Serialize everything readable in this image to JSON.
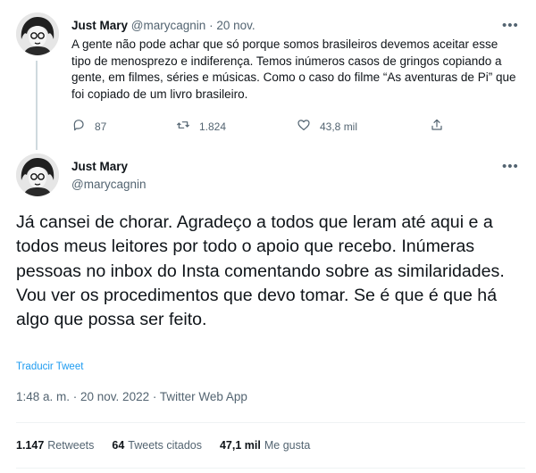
{
  "tweet1": {
    "name": "Just Mary",
    "handle": "@marycagnin",
    "separator": "·",
    "date": "20 nov.",
    "text": "A gente não pode achar que só porque somos brasileiros devemos aceitar esse tipo de menosprezo e indiferença. Temos inúmeros casos de gringos copiando a gente, em filmes, séries e músicas. Como o caso do filme “As aventuras de Pi” que foi copiado de um livro brasileiro.",
    "replies": "87",
    "retweets": "1.824",
    "likes": "43,8 mil",
    "icons": [
      "reply-icon",
      "retweet-icon",
      "heart-icon",
      "share-icon"
    ]
  },
  "tweet2": {
    "name": "Just Mary",
    "handle": "@marycagnin",
    "text": "Já cansei de chorar. Agradeço a todos que leram até aqui e a todos meus leitores por todo o apoio que recebo. Inúmeras pessoas no inbox do Insta comentando sobre as similaridades. Vou ver os procedimentos que devo tomar. Se é que é que há algo que possa ser feito.",
    "translate": "Traducir Tweet",
    "meta": "1:48 a. m. · 20 nov. 2022 · Twitter Web App",
    "stats": {
      "retweets_count": "1.147",
      "retweets_label": "Retweets",
      "quotes_count": "64",
      "quotes_label": "Tweets citados",
      "likes_count": "47,1 mil",
      "likes_label": "Me gusta"
    }
  },
  "colors": {
    "link": "#1d9bf0",
    "muted": "#536471",
    "text": "#0f1419"
  }
}
